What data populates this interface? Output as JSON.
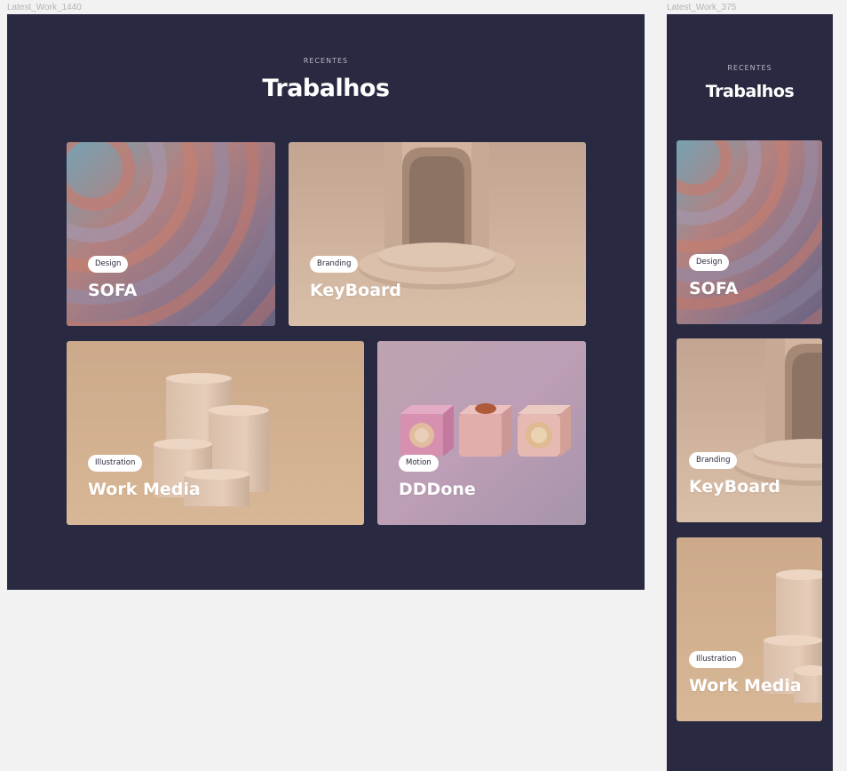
{
  "canvas": {
    "desktop_frame_label": "Latest_Work_1440",
    "mobile_frame_label": "Latest_Work_375"
  },
  "section": {
    "eyebrow": "RECENTES",
    "title": "Trabalhos"
  },
  "cards": [
    {
      "category": "Design",
      "title": "SOFA"
    },
    {
      "category": "Branding",
      "title": "KeyBoard"
    },
    {
      "category": "Illustration",
      "title": "Work Media"
    },
    {
      "category": "Motion",
      "title": "DDDone"
    }
  ],
  "colors": {
    "canvas_bg": "#f2f2f2",
    "frame_bg": "#292a41",
    "badge_bg": "#ffffff",
    "title_text": "#ffffff"
  }
}
